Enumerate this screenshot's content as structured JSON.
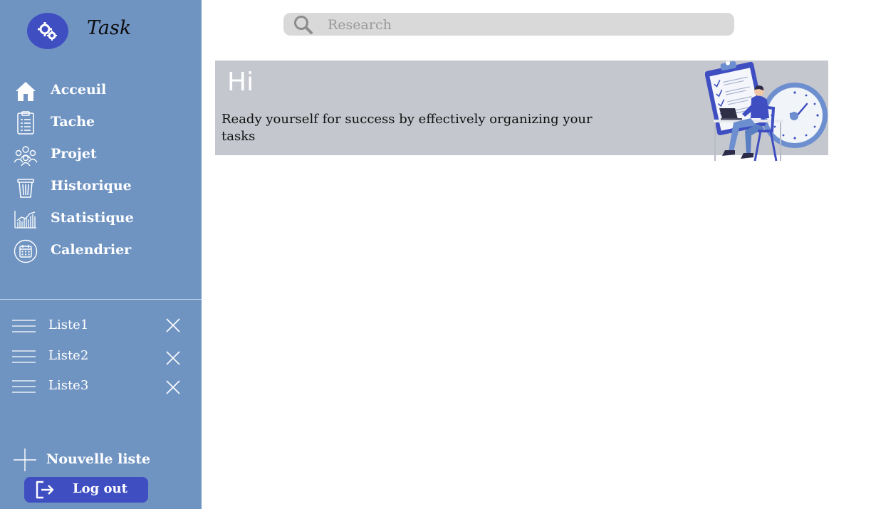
{
  "brand": {
    "title": "Task",
    "icon": "gears-icon"
  },
  "nav": {
    "items": [
      {
        "label": "Acceuil",
        "icon": "home-icon"
      },
      {
        "label": "Tache",
        "icon": "todo-clipboard-icon"
      },
      {
        "label": "Projet",
        "icon": "team-icon"
      },
      {
        "label": "Historique",
        "icon": "trash-icon"
      },
      {
        "label": "Statistique",
        "icon": "bar-chart-icon"
      },
      {
        "label": "Calendrier",
        "icon": "calendar-icon"
      }
    ]
  },
  "lists": {
    "items": [
      {
        "label": "Liste1"
      },
      {
        "label": "Liste2"
      },
      {
        "label": "Liste3"
      }
    ]
  },
  "new_list": {
    "label": "Nouvelle liste"
  },
  "logout": {
    "label": "Log out"
  },
  "search": {
    "placeholder": "Research",
    "value": ""
  },
  "banner": {
    "greeting": "Hi",
    "subtitle": "Ready yourself for success by effectively organizing your tasks"
  },
  "colors": {
    "sidebar": "#7094c2",
    "accent": "#3f4fc2",
    "banner": "#c5c7ce",
    "search": "#d9d9d9"
  }
}
